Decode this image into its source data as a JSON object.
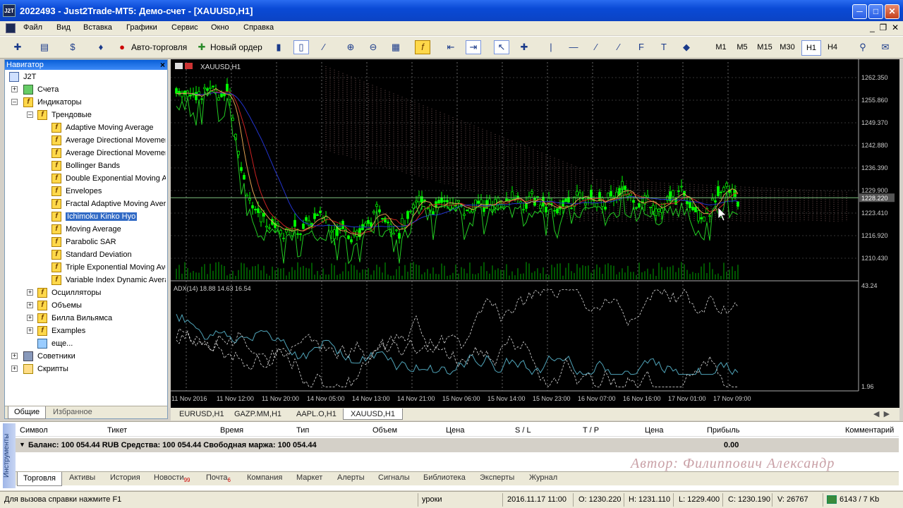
{
  "window": {
    "title": "2022493 - Just2Trade-MT5: Демо-счет - [XAUUSD,H1]",
    "icon_label": "J2T"
  },
  "menu": [
    "Файл",
    "Вид",
    "Вставка",
    "Графики",
    "Сервис",
    "Окно",
    "Справка"
  ],
  "toolbar": {
    "autotrade_label": "Авто-торговля",
    "new_order_label": "Новый ордер",
    "timeframes": [
      "M1",
      "M5",
      "M15",
      "M30",
      "H1",
      "H4"
    ],
    "active_timeframe": "H1"
  },
  "navigator": {
    "title": "Навигатор",
    "root": "J2T",
    "accounts": "Счета",
    "indicators": "Индикаторы",
    "trend": "Трендовые",
    "trend_items": [
      "Adaptive Moving Average",
      "Average Directional Movement Index",
      "Average Directional Movement Index Wilder",
      "Bollinger Bands",
      "Double Exponential Moving Average",
      "Envelopes",
      "Fractal Adaptive Moving Average",
      "Ichimoku Kinko Hyo",
      "Moving Average",
      "Parabolic SAR",
      "Standard Deviation",
      "Triple Exponential Moving Average",
      "Variable Index Dynamic Average"
    ],
    "selected_item": "Ichimoku Kinko Hyo",
    "groups": [
      "Осцилляторы",
      "Объемы",
      "Билла Вильямса",
      "Examples"
    ],
    "more": "еще...",
    "experts": "Советники",
    "scripts": "Скрипты",
    "tabs": [
      "Общие",
      "Избранное"
    ]
  },
  "chart": {
    "symbol_label": "XAUUSD,H1",
    "adx_label": "ADX(14) 18.88 14.63 16.54",
    "price_ticks": [
      "1262.350",
      "1255.860",
      "1249.370",
      "1242.880",
      "1236.390",
      "1229.900",
      "1223.410",
      "1216.920",
      "1210.430"
    ],
    "current_price": "1228.220",
    "adx_ticks": [
      "43.24",
      "1.96"
    ],
    "time_ticks": [
      "11 Nov 2016",
      "11 Nov 12:00",
      "11 Nov 20:00",
      "14 Nov 05:00",
      "14 Nov 13:00",
      "14 Nov 21:00",
      "15 Nov 06:00",
      "15 Nov 14:00",
      "15 Nov 23:00",
      "16 Nov 07:00",
      "16 Nov 16:00",
      "17 Nov 01:00",
      "17 Nov 09:00"
    ],
    "colors": {
      "bull": "#00ff00",
      "bear": "#00ff00",
      "background": "#000000",
      "adx": "#4fa3b8"
    }
  },
  "chart_tabs": [
    "EURUSD,H1",
    "GAZP.MM,H1",
    "AAPL.O,H1",
    "XAUUSD,H1"
  ],
  "active_chart_tab": "XAUUSD,H1",
  "toolbox": {
    "side_label": "Инструменты",
    "columns": [
      "Символ",
      "Тикет",
      "Время",
      "Тип",
      "Объем",
      "Цена",
      "S / L",
      "T / P",
      "Цена",
      "Прибыль",
      "Комментарий"
    ],
    "balance_text": "Баланс: 100 054.44 RUB  Средства: 100 054.44  Свободная маржа: 100 054.44",
    "profit_total": "0.00",
    "tabs": [
      "Торговля",
      "Активы",
      "История",
      "Новости",
      "Почта",
      "Компания",
      "Маркет",
      "Алерты",
      "Сигналы",
      "Библиотека",
      "Эксперты",
      "Журнал"
    ],
    "news_count": "99",
    "mail_count": "6",
    "active_tab": "Торговля"
  },
  "author": "Автор: Филиппович Александр",
  "status": {
    "help": "Для вызова справки нажмите F1",
    "profile": "уроки",
    "datetime": "2016.11.17 11:00",
    "open": "O: 1230.220",
    "high": "H: 1231.110",
    "low": "L: 1229.400",
    "close": "C: 1230.190",
    "volume": "V: 26767",
    "traffic": "6143 / 7 Kb"
  }
}
